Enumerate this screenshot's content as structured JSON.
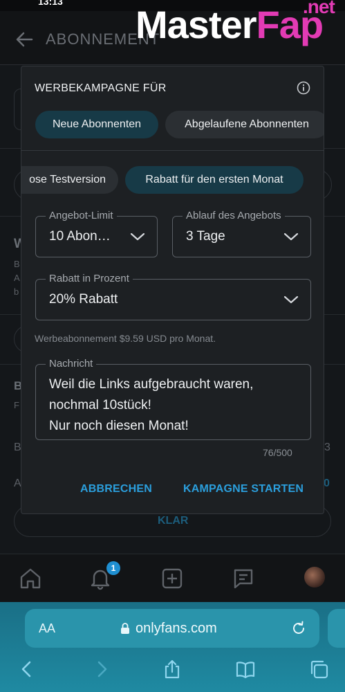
{
  "status_bar": {
    "time": "13:13"
  },
  "header": {
    "title": "ABONNEMENT",
    "watermark_main": "Master",
    "watermark_accent": "Fap",
    "watermark_suffix": ".net"
  },
  "background": {
    "letter_w": "W",
    "letters_left": [
      "B",
      "A",
      "b"
    ],
    "letter_b2": "B",
    "letter_f": "F",
    "row1_left": "B",
    "row1_right": "3",
    "row2_left": "A",
    "row2_right": "0",
    "clear_button": "KLAR"
  },
  "modal": {
    "title": "WERBEKAMPAGNE FÜR",
    "audience_chips": [
      {
        "label": "Neue Abonnenten",
        "active": true
      },
      {
        "label": "Abgelaufene Abonnenten",
        "active": false
      }
    ],
    "type_chips": [
      {
        "label": "ose Testversion",
        "active": false
      },
      {
        "label": "Rabatt für den ersten Monat",
        "active": true
      }
    ],
    "offer_limit": {
      "label": "Angebot-Limit",
      "value": "10 Abon…"
    },
    "offer_expiry": {
      "label": "Ablauf des Angebots",
      "value": "3 Tage"
    },
    "discount": {
      "label": "Rabatt in Prozent",
      "value": "20% Rabatt"
    },
    "hint": "Werbeabonnement $9.59 USD pro Monat.",
    "message": {
      "label": "Nachricht",
      "lines": [
        "Weil die Links aufgebraucht waren,",
        "nochmal 10stück!",
        "Nur noch diesen Monat!"
      ]
    },
    "counter": "76/500",
    "cancel_label": "ABBRECHEN",
    "start_label": "KAMPAGNE STARTEN"
  },
  "bottom_nav": {
    "notification_count": "1"
  },
  "browser": {
    "aa_label": "AA",
    "url": "onlyfans.com"
  },
  "colors": {
    "accent": "#2b9fdd",
    "chip_active": "#173a47",
    "safari": "#1f8aa2"
  }
}
